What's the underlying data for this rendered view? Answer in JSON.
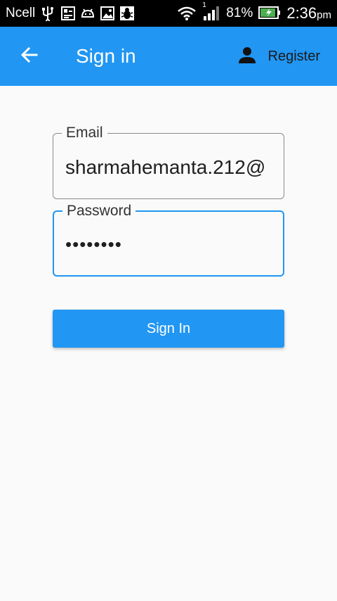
{
  "status_bar": {
    "carrier": "Ncell",
    "battery_percent": "81%",
    "time": "2:36",
    "time_suffix": "pm",
    "signal_sim": "1",
    "icons": [
      "usb-icon",
      "screenshot-icon",
      "android-icon",
      "image-icon",
      "bug-icon",
      "wifi-icon",
      "signal-icon",
      "battery-charging-icon"
    ]
  },
  "app_bar": {
    "title": "Sign in",
    "register_label": "Register",
    "background": "#2196f3"
  },
  "form": {
    "email_label": "Email",
    "email_value": "sharmahemanta.212@",
    "password_label": "Password",
    "password_value": "••••••••",
    "submit_label": "Sign In",
    "accent": "#2196f3"
  }
}
